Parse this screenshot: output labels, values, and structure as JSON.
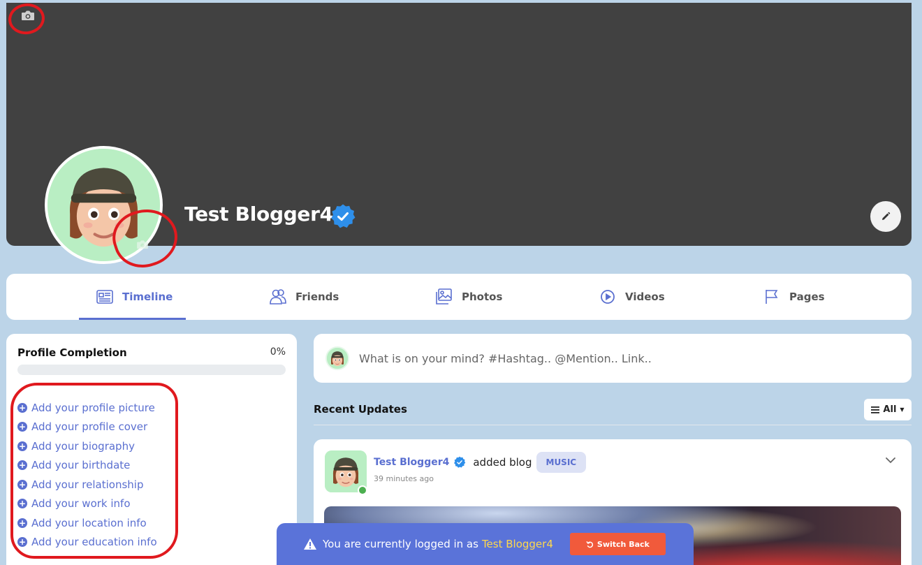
{
  "profile": {
    "name": "Test Blogger4",
    "verified": true
  },
  "tabs": [
    {
      "label": "Timeline",
      "icon": "newspaper-icon",
      "active": true
    },
    {
      "label": "Friends",
      "icon": "users-icon",
      "active": false
    },
    {
      "label": "Photos",
      "icon": "image-icon",
      "active": false
    },
    {
      "label": "Videos",
      "icon": "video-play-icon",
      "active": false
    },
    {
      "label": "Pages",
      "icon": "flag-icon",
      "active": false
    }
  ],
  "profile_completion": {
    "title": "Profile Completion",
    "percent_label": "0%",
    "progress": 0,
    "items": [
      "Add your profile picture",
      "Add your profile cover",
      "Add your biography",
      "Add your birthdate",
      "Add your relationship",
      "Add your work info",
      "Add your location info",
      "Add your education info"
    ]
  },
  "composer": {
    "placeholder": "What is on your mind? #Hashtag.. @Mention.. Link.."
  },
  "recent": {
    "title": "Recent Updates",
    "filter_label": "All"
  },
  "post": {
    "author": "Test Blogger4",
    "action": "added blog",
    "category": "MUSIC",
    "time": "39 minutes ago"
  },
  "banner": {
    "text": "You are currently logged in as",
    "user": "Test Blogger4",
    "switch_label": "Switch Back"
  },
  "colors": {
    "accent": "#5a6fd0",
    "annotation": "#e0191e",
    "banner": "#5a73d9",
    "switch": "#f15a3b",
    "background": "#bcd4e8"
  }
}
